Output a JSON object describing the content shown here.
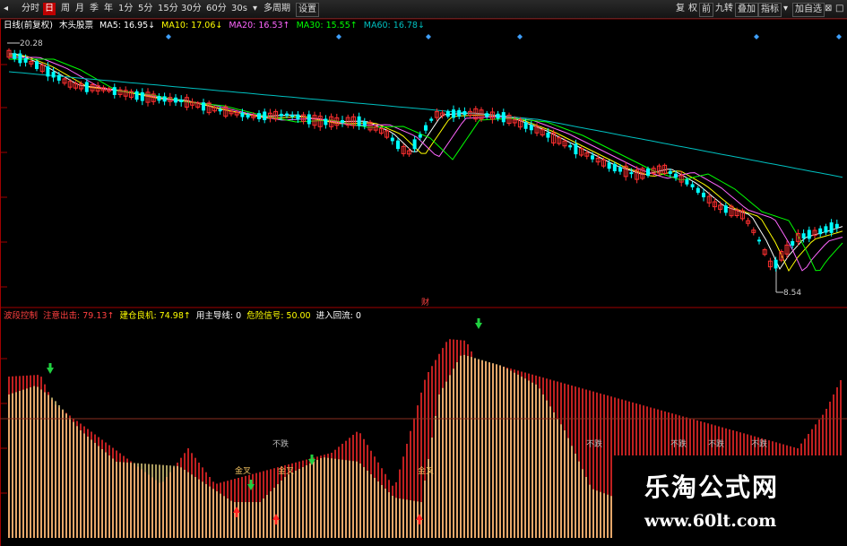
{
  "toolbar": {
    "items": [
      "◂",
      "分时",
      "日",
      "周",
      "月",
      "季",
      "年",
      "1分",
      "5分",
      "15分",
      "30分",
      "60分",
      "30s",
      "▾",
      "多周期",
      "设置"
    ],
    "right_items": [
      "复",
      "权",
      "前",
      "九转",
      "叠加",
      "指标",
      "▾",
      "加自选",
      "⊠",
      "□"
    ]
  },
  "ma_bar": {
    "period": "日线(前复权)",
    "name": "木头股票",
    "ma5": "MA5: 16.95↓",
    "ma10": "MA10: 17.06↓",
    "ma20": "MA20: 16.53↑",
    "ma30": "MA30: 15.55↑",
    "ma60": "MA60: 16.78↓"
  },
  "price_labels": {
    "high": "20.28",
    "low": "8.54",
    "marker": "财"
  },
  "indicator_bar": {
    "name": "波段控制",
    "v1": "注意出击: 79.13↑",
    "v2": "建仓良机: 74.98↑",
    "v3": "用主导线: 0",
    "v4": "危险信号: 50.00",
    "v5": "进入回流: 0"
  },
  "signals": {
    "sell": "不跌",
    "buy": "金叉"
  },
  "watermark": {
    "title": "乐淘公式网",
    "url": "www.60lt.com"
  },
  "colors": {
    "up": "#ff3030",
    "down": "#00ffff",
    "ma5": "#ffffff",
    "ma10": "#ffff00",
    "ma20": "#ff66ff",
    "ma30": "#00ff00",
    "ma60": "#00c0c0",
    "bar_yellow": "#f5e08a",
    "bar_red": "#c02020",
    "bar_orange": "#c08040"
  }
}
